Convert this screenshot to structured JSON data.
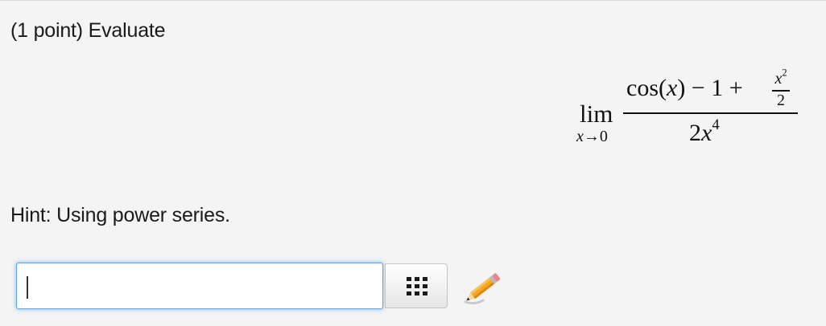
{
  "problem": {
    "header": "(1 point) Evaluate",
    "hint": "Hint: Using power series."
  },
  "math": {
    "lim_word": "lim",
    "lim_sub_var": "x",
    "lim_sub_arrow": "→0",
    "numerator_func": "cos(",
    "numerator_var": "x",
    "numerator_rest": ") − 1 + ",
    "small_frac_num_var": "x",
    "small_frac_num_exp": "2",
    "small_frac_den": "2",
    "denominator_coef": "2",
    "denominator_var": "x",
    "denominator_exp": "4"
  },
  "answer": {
    "value": ""
  },
  "icons": {
    "equation_editor": "keypad-icon",
    "pencil": "pencil-icon"
  },
  "colors": {
    "focus_glow": "#52a8ec",
    "pencil_body": "#f5a623"
  }
}
